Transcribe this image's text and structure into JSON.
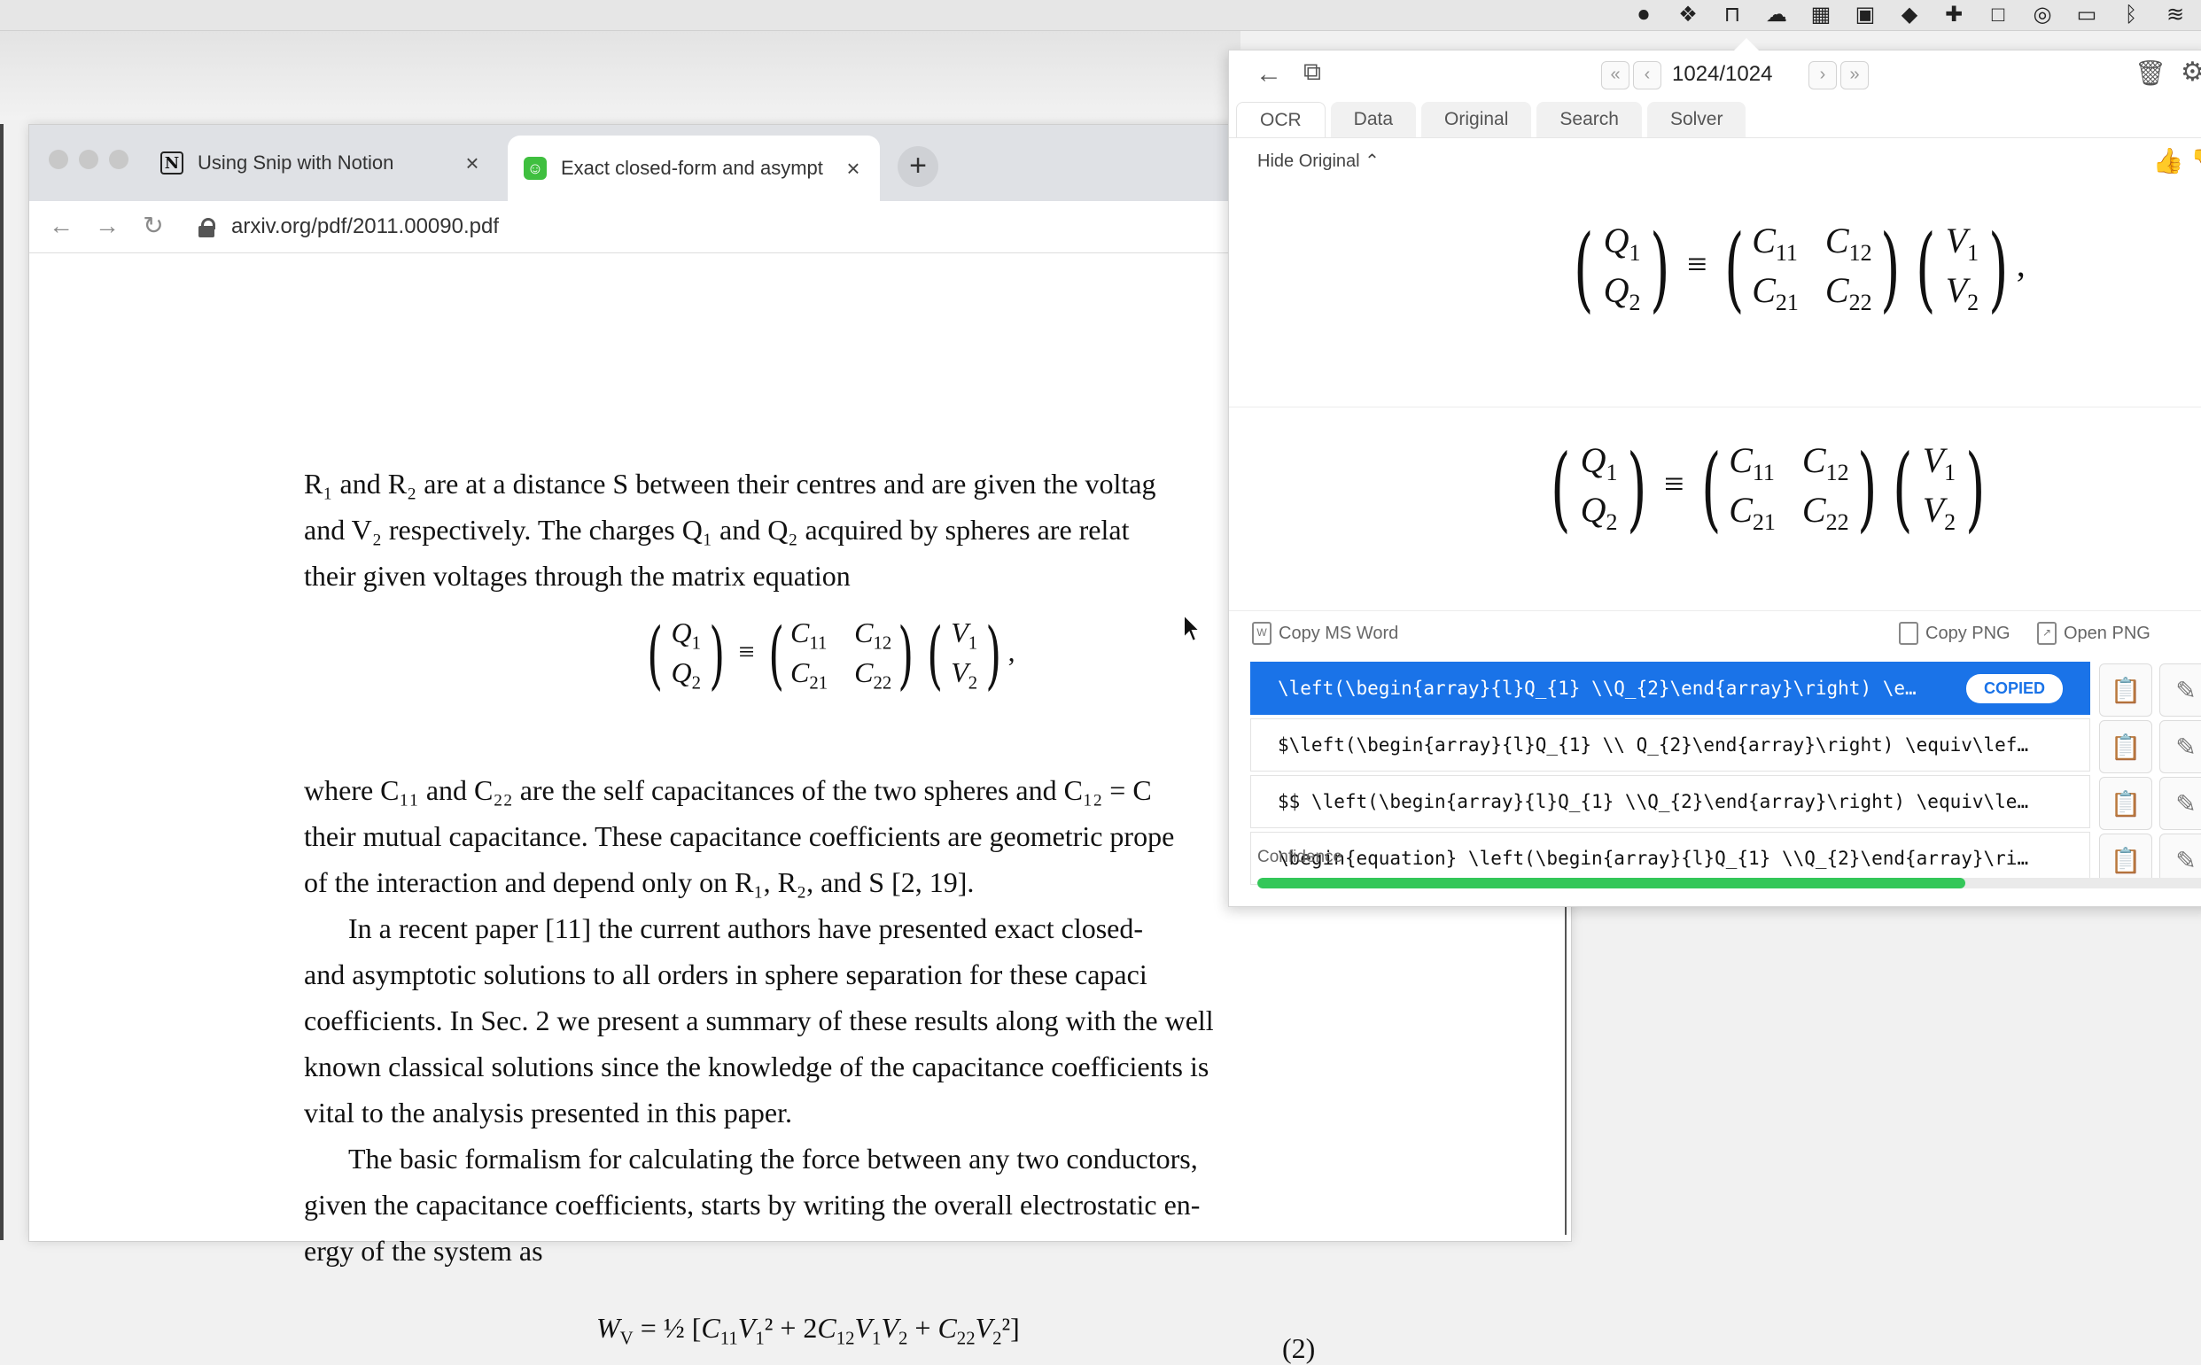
{
  "browser": {
    "tabs": [
      {
        "label": "Using Snip with Notion",
        "icon": "notion-icon"
      },
      {
        "label": "Exact closed-form and asympt",
        "icon": "snip-favicon"
      }
    ],
    "url": "arxiv.org/pdf/2011.00090.pdf"
  },
  "pdf": {
    "p1": [
      "R₁ and R₂ are at a distance S between their centres and are given the voltag",
      "and V₂ respectively.  The charges Q₁ and Q₂ acquired by spheres are relat",
      "their given voltages through the matrix equation"
    ],
    "p2": [
      "where C₁₁ and C₂₂ are the self capacitances of the two spheres and C₁₂ = C",
      "their mutual capacitance. These capacitance coefficients are geometric prope",
      "of the interaction and depend only on R₁, R₂, and S  [2, 19]."
    ],
    "p3": [
      "In a recent paper [11] the current authors have presented exact closed-",
      "and asymptotic solutions to all orders in sphere separation for these capaci",
      "coefficients. In Sec. 2 we present a summary of these results along with the well",
      "known classical solutions since the knowledge of the capacitance coefficients is",
      "vital to the analysis presented in this paper."
    ],
    "p4": [
      "The basic formalism for calculating the force between any two conductors,",
      "given the capacitance coefficients, starts by writing the overall electrostatic en-",
      "ergy of the system as"
    ],
    "eq2_number": "(2)"
  },
  "snip": {
    "counter": "1024/1024",
    "tabs": [
      "OCR",
      "Data",
      "Original",
      "Search",
      "Solver"
    ],
    "hide_original": "Hide Original",
    "copy_ms_word": "Copy MS Word",
    "copy_png": "Copy PNG",
    "open_png": "Open PNG",
    "results": [
      "\\left(\\begin{array}{l}Q_{1} \\\\Q_{2}\\end{array}\\right) \\e…",
      "$\\left(\\begin{array}{l}Q_{1} \\\\ Q_{2}\\end{array}\\right) \\equiv\\lef…",
      "$$ \\left(\\begin{array}{l}Q_{1} \\\\Q_{2}\\end{array}\\right) \\equiv\\le…",
      "\\begin{equation} \\left(\\begin{array}{l}Q_{1} \\\\Q_{2}\\end{array}\\ri…"
    ],
    "copied_badge": "COPIED",
    "confidence_label": "Confidence",
    "confidence": 0.74
  },
  "colors": {
    "accent": "#1a73e8",
    "confidence": "#34c759"
  }
}
